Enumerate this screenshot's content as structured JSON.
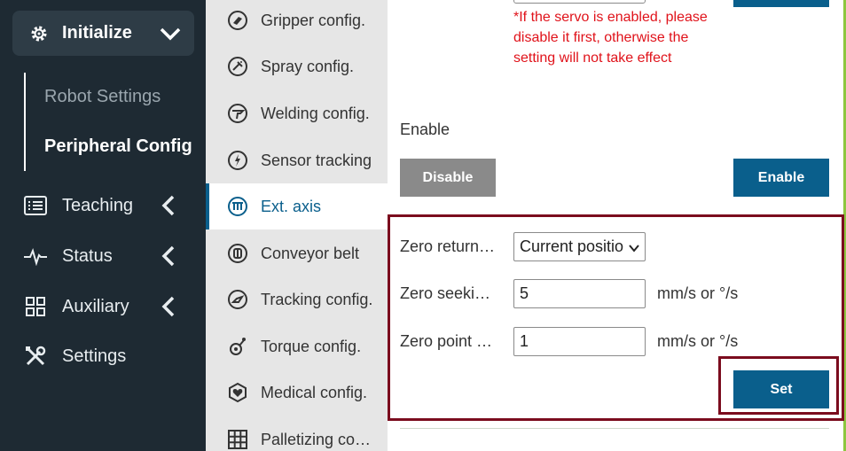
{
  "sidebar": {
    "initialize_label": "Initialize",
    "sub_items": [
      "Robot Settings",
      "Peripheral Config"
    ],
    "nav": [
      {
        "label": "Teaching",
        "icon": "list-icon"
      },
      {
        "label": "Status",
        "icon": "pulse-icon"
      },
      {
        "label": "Auxiliary",
        "icon": "grid-icon"
      },
      {
        "label": "Settings",
        "icon": "tools-icon"
      }
    ]
  },
  "menu2": {
    "items": [
      {
        "label": "Gripper config.",
        "icon": "gripper-icon"
      },
      {
        "label": "Spray config.",
        "icon": "spray-icon"
      },
      {
        "label": "Welding config.",
        "icon": "welding-icon"
      },
      {
        "label": "Sensor tracking",
        "icon": "sensor-icon"
      },
      {
        "label": "Ext. axis",
        "icon": "ext-axis-icon"
      },
      {
        "label": "Conveyor belt",
        "icon": "conveyor-icon"
      },
      {
        "label": "Tracking config.",
        "icon": "tracking-icon"
      },
      {
        "label": "Torque config.",
        "icon": "torque-icon"
      },
      {
        "label": "Medical config.",
        "icon": "medical-icon"
      },
      {
        "label": "Palletizing co…",
        "icon": "palletizing-icon"
      }
    ],
    "active_index": 4
  },
  "main": {
    "warning": "*If the servo is enabled, please disable it first, otherwise the setting will not take effect",
    "enable_label": "Enable",
    "disable_button": "Disable",
    "enable_button": "Enable",
    "zero_return_label": "Zero return…",
    "zero_return_value": "Current positio",
    "zero_seek_label": "Zero seeki…",
    "zero_seek_value": "5",
    "zero_seek_unit": "mm/s or °/s",
    "zero_point_label": "Zero point …",
    "zero_point_value": "1",
    "zero_point_unit": "mm/s or °/s",
    "set_button": "Set"
  },
  "colors": {
    "sidebar_bg": "#1e2a33",
    "accent": "#0a5f8c",
    "highlight_border": "#7b0c1e",
    "warning_text": "#e0121a"
  }
}
